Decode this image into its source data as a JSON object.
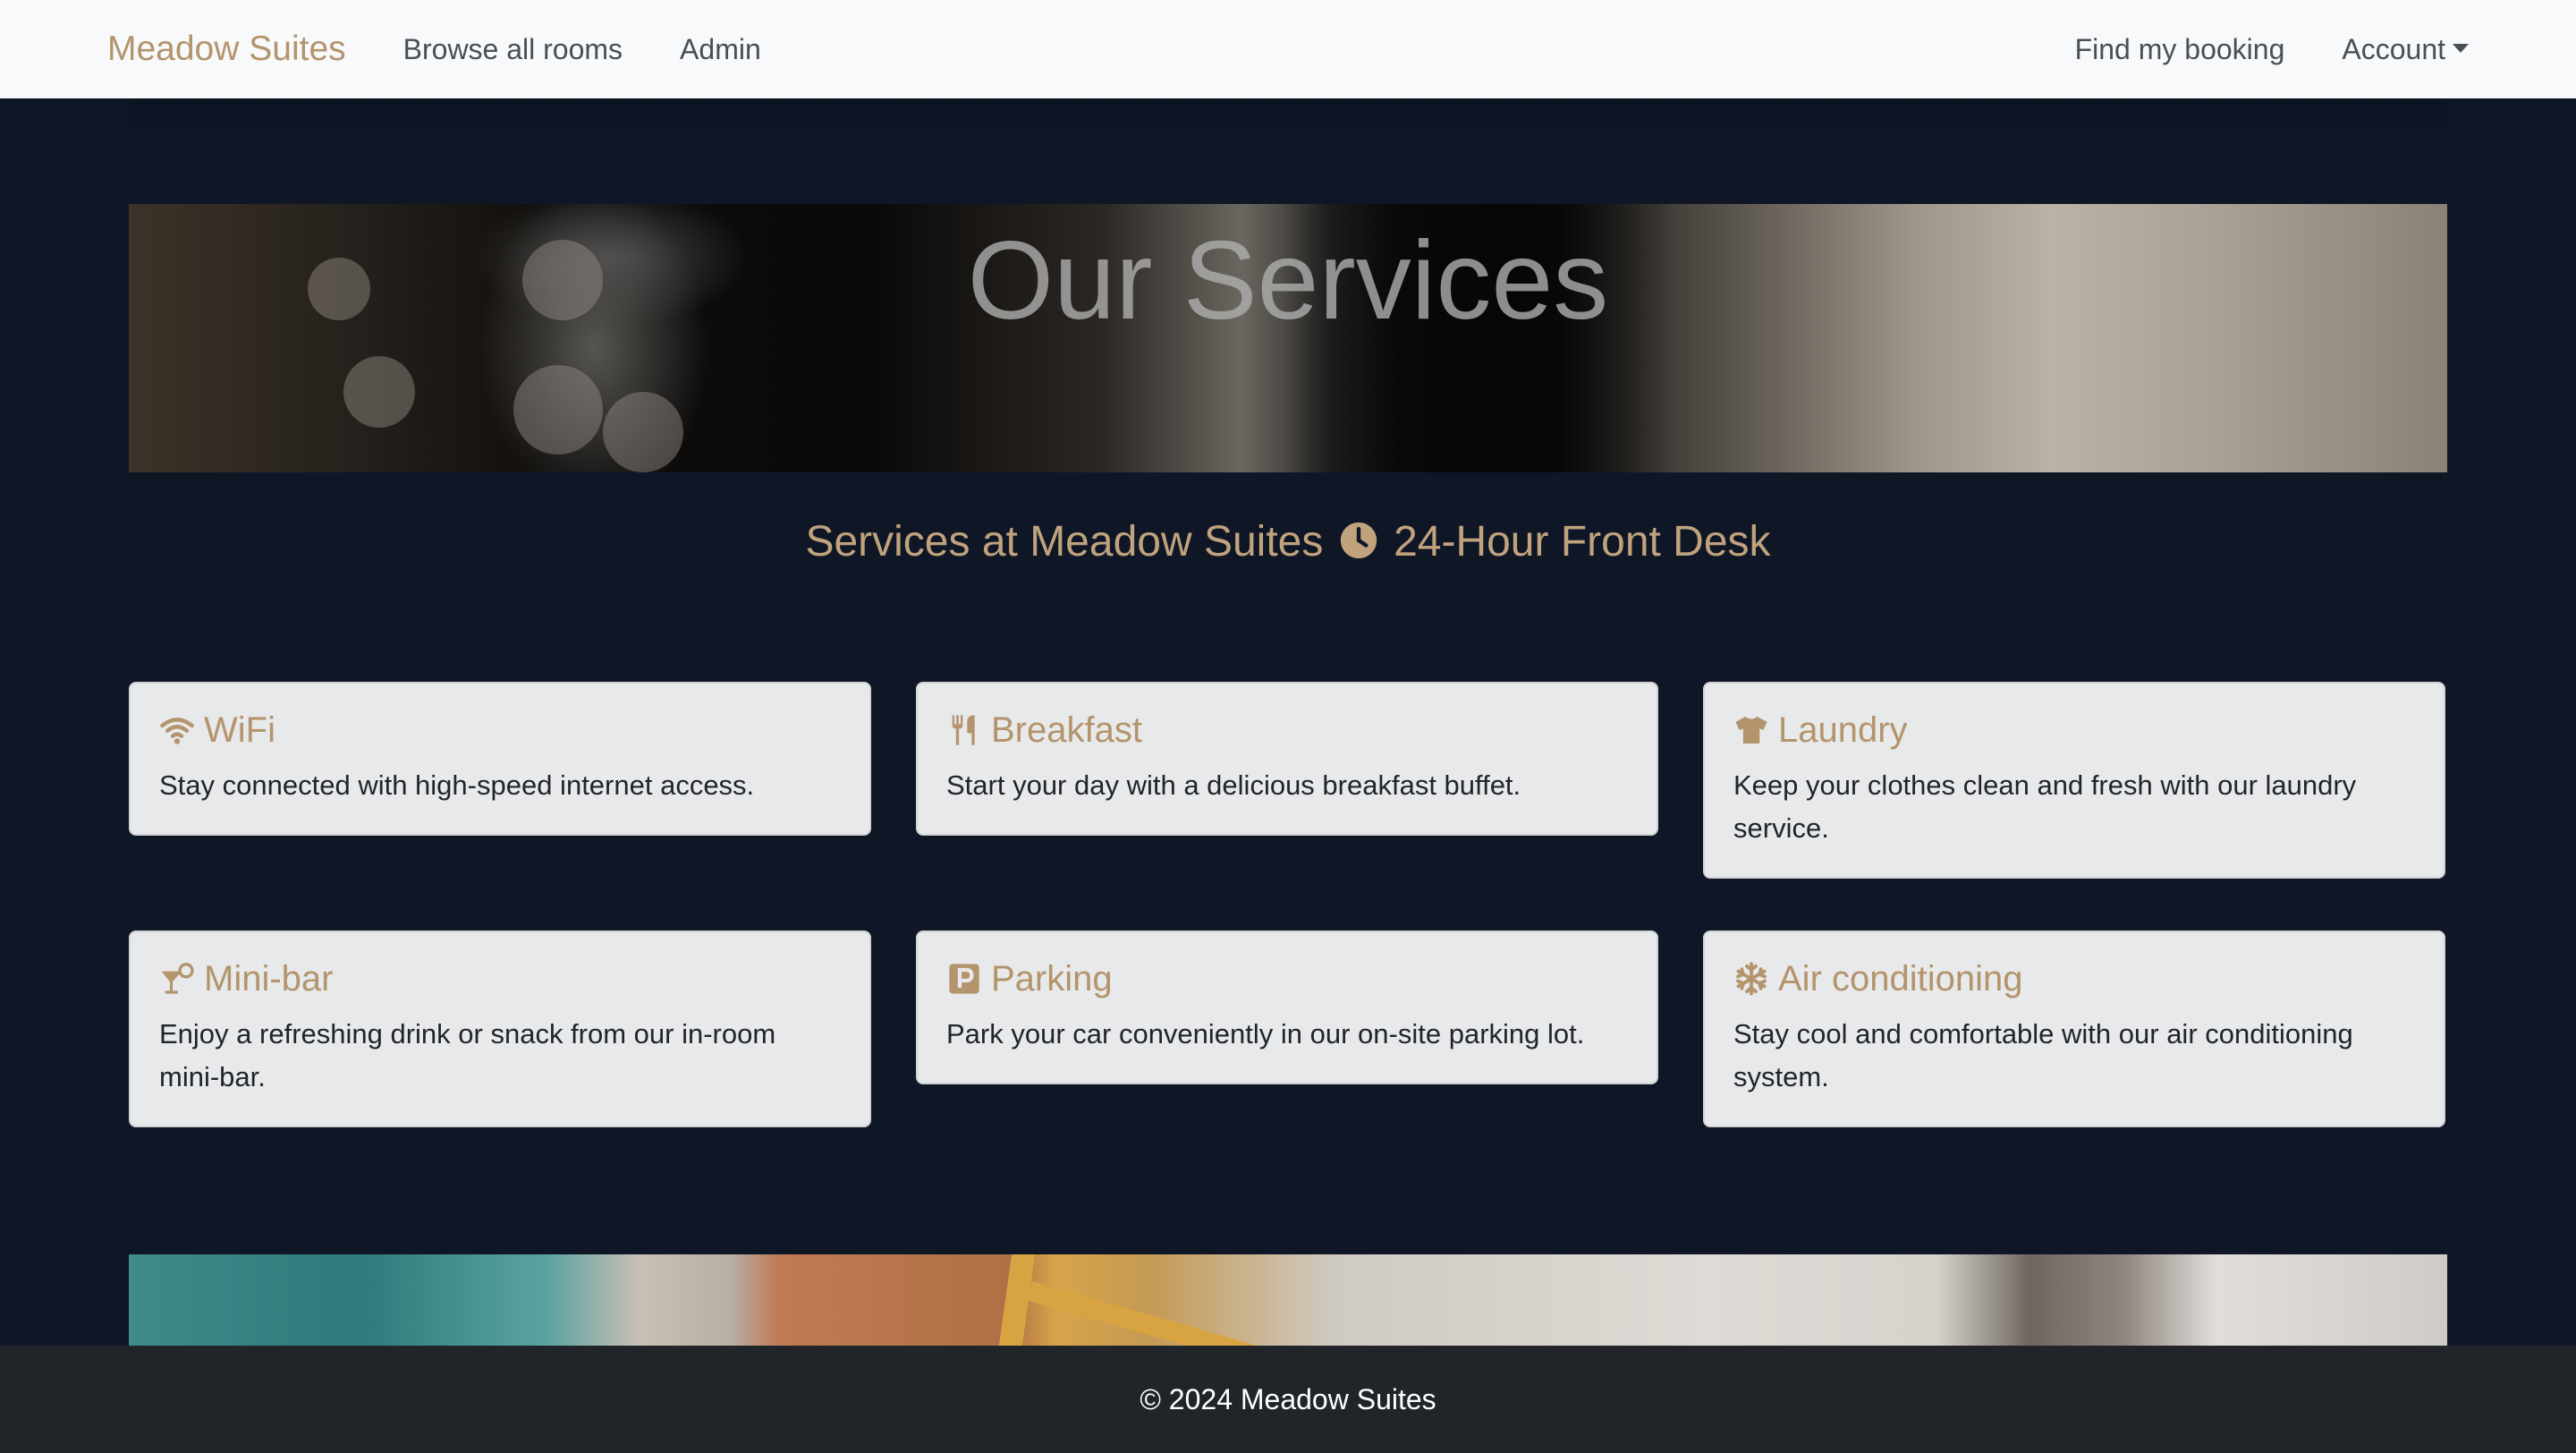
{
  "navbar": {
    "brand": "Meadow Suites",
    "links": [
      "Browse all rooms",
      "Admin"
    ],
    "right_links": [
      "Find my booking",
      "Account"
    ]
  },
  "hero": {
    "title": "Our Services"
  },
  "subtitle": {
    "prefix": "Services at Meadow Suites",
    "icon": "clock-icon",
    "suffix": "24-Hour Front Desk"
  },
  "services": [
    {
      "title": "WiFi",
      "icon": "wifi-icon",
      "text": "Stay connected with high-speed internet access."
    },
    {
      "title": "Breakfast",
      "icon": "utensils-icon",
      "text": "Start your day with a delicious breakfast buffet."
    },
    {
      "title": "Laundry",
      "icon": "shirt-icon",
      "text": "Keep your clothes clean and fresh with our laundry service."
    },
    {
      "title": "Mini-bar",
      "icon": "cocktail-icon",
      "text": "Enjoy a refreshing drink or snack from our in-room mini-bar."
    },
    {
      "title": "Parking",
      "icon": "parking-icon",
      "text": "Park your car conveniently in our on-site parking lot."
    },
    {
      "title": "Air conditioning",
      "icon": "snowflake-icon",
      "text": "Stay cool and comfortable with our air conditioning system."
    }
  ],
  "footer": {
    "text": "© 2024 Meadow Suites"
  },
  "colors": {
    "accent": "#b3946c",
    "background": "#0f1727",
    "card": "#e8e9ea",
    "footer": "#212529"
  }
}
